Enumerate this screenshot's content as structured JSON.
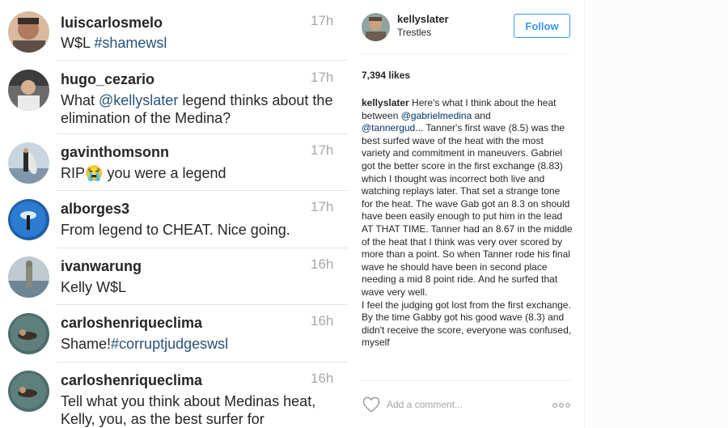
{
  "comments": [
    {
      "username": "luiscarlosmelo",
      "time": "17h",
      "text_plain": "W$L ",
      "text_link": "#shamewsl",
      "text_after": ""
    },
    {
      "username": "hugo_cezario",
      "time": "17h",
      "text_plain": "What ",
      "text_link": "@kellyslater",
      "text_after": " legend thinks about the elimination of the Medina?"
    },
    {
      "username": "gavinthomsonn",
      "time": "17h",
      "text_plain": "RIP",
      "emoji": "😭",
      "text_after": " you were a legend"
    },
    {
      "username": "alborges3",
      "time": "17h",
      "text_plain": "From legend to CHEAT.  Nice going."
    },
    {
      "username": "ivanwarung",
      "time": "16h",
      "text_plain": "Kelly W$L"
    },
    {
      "username": "carloshenriqueclima",
      "time": "16h",
      "text_plain": "Shame!",
      "text_link": "#corruptjudgeswsl",
      "text_after": ""
    },
    {
      "username": "carloshenriqueclima",
      "time": "16h",
      "text_plain": "Tell what you think about Medinas heat, Kelly, you, as the best surfer for"
    }
  ],
  "post": {
    "username": "kellyslater",
    "location": "Trestles",
    "follow_label": "Follow",
    "likes": "7,394 likes",
    "caption_user": "kellyslater",
    "caption_part1": " Here's what I think about the heat between ",
    "caption_mention1": "@gabrielmedina",
    "caption_part2": " and ",
    "caption_mention2": "@tannergud",
    "caption_part3": "... Tanner's first wave (8.5) was the best surfed wave of the heat with the most variety and commitment in maneuvers. Gabriel got the better score in the first exchange (8.83) which I thought was incorrect both live and watching replays later. That set a strange tone for the heat. The wave Gab got an 8.3 on should have been easily enough to put him in the lead AT THAT TIME. Tanner had an 8.67 in the middle of the heat that I think was very over scored by more than a point. So when Tanner rode his final wave he should have been in second place needing a mid 8 point ride. And he surfed that wave very well.",
    "caption_part4": "I feel the judging got lost from the first exchange. By the time Gabby got his good wave (8.3) and didn't receive the score, everyone was confused, myself",
    "comment_placeholder": "Add a comment...",
    "icons": {
      "like": "heart-icon",
      "more": "more-options-icon"
    }
  },
  "colors": {
    "follow": "#3897f0",
    "hashtag": "#27537a",
    "time": "#a8a8a8"
  }
}
